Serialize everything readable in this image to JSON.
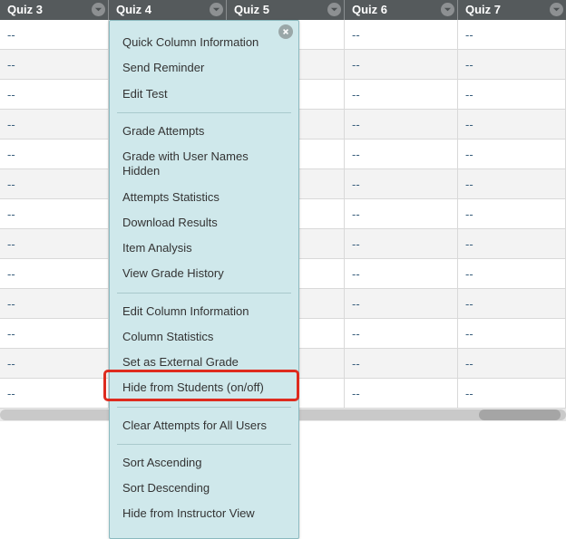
{
  "columns": [
    {
      "label": "Quiz 3"
    },
    {
      "label": "Quiz 4"
    },
    {
      "label": "Quiz 5"
    },
    {
      "label": "Quiz 6"
    },
    {
      "label": "Quiz 7"
    }
  ],
  "empty_cell": "--",
  "row_count": 13,
  "menu": {
    "groups": [
      [
        {
          "label": "Quick Column Information"
        },
        {
          "label": "Send Reminder"
        },
        {
          "label": "Edit Test"
        }
      ],
      [
        {
          "label": "Grade Attempts"
        },
        {
          "label": "Grade with User Names Hidden"
        },
        {
          "label": "Attempts Statistics"
        },
        {
          "label": "Download Results"
        },
        {
          "label": "Item Analysis"
        },
        {
          "label": "View Grade History"
        }
      ],
      [
        {
          "label": "Edit Column Information"
        },
        {
          "label": "Column Statistics"
        },
        {
          "label": "Set as External Grade"
        },
        {
          "label": "Hide from Students (on/off)",
          "highlighted": true
        }
      ],
      [
        {
          "label": "Clear Attempts for All Users"
        }
      ],
      [
        {
          "label": "Sort Ascending"
        },
        {
          "label": "Sort Descending"
        },
        {
          "label": "Hide from Instructor View"
        }
      ]
    ]
  }
}
